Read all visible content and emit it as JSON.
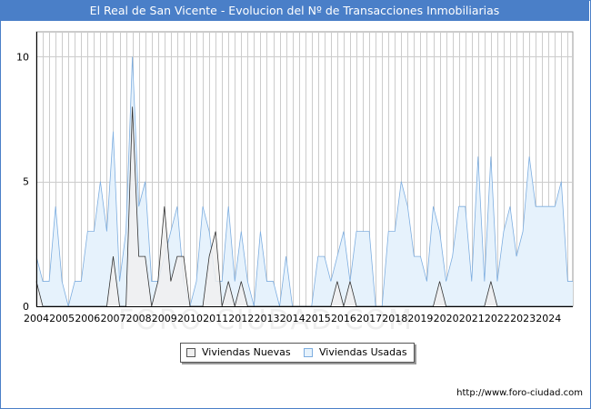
{
  "chart_data": {
    "type": "area",
    "title": "El Real de San Vicente - Evolucion del Nº de Transacciones Inmobiliarias",
    "xlabel": "",
    "ylabel": "",
    "x_tick_labels": [
      "2004",
      "2005",
      "2006",
      "2007",
      "2008",
      "2009",
      "2010",
      "2011",
      "2012",
      "2013",
      "2014",
      "2015",
      "2016",
      "2017",
      "2018",
      "2019",
      "2020",
      "2021",
      "2022",
      "2023",
      "2024"
    ],
    "y_ticks": [
      0,
      5,
      10
    ],
    "xlim": [
      2004,
      2024.95
    ],
    "ylim": [
      0,
      11
    ],
    "grid": true,
    "legend_position": "bottom-center",
    "series": [
      {
        "name": "Viviendas Nuevas",
        "color": "#f0f0f0",
        "stroke": "#333333",
        "x": [
          2004.0,
          2004.25,
          2004.5,
          2004.75,
          2005.0,
          2005.25,
          2005.5,
          2005.75,
          2006.0,
          2006.25,
          2006.5,
          2006.75,
          2007.0,
          2007.25,
          2007.5,
          2007.75,
          2008.0,
          2008.25,
          2008.5,
          2008.75,
          2009.0,
          2009.25,
          2009.5,
          2009.75,
          2010.0,
          2010.25,
          2010.5,
          2010.75,
          2011.0,
          2011.25,
          2011.5,
          2011.75,
          2012.0,
          2012.25,
          2012.5,
          2012.75,
          2013.0,
          2013.25,
          2013.5,
          2013.75,
          2014.0,
          2014.25,
          2014.5,
          2014.75,
          2015.0,
          2015.25,
          2015.5,
          2015.75,
          2016.0,
          2016.25,
          2016.5,
          2016.75,
          2017.0,
          2017.25,
          2017.5,
          2017.75,
          2018.0,
          2018.25,
          2018.5,
          2018.75,
          2019.0,
          2019.25,
          2019.5,
          2019.75,
          2020.0,
          2020.25,
          2020.5,
          2020.75,
          2021.0,
          2021.25,
          2021.5,
          2021.75,
          2022.0,
          2022.25,
          2022.5,
          2022.75,
          2023.0,
          2023.25,
          2023.5,
          2023.75,
          2024.0,
          2024.25,
          2024.5,
          2024.75,
          2024.95
        ],
        "values": [
          1,
          0,
          0,
          0,
          0,
          0,
          0,
          0,
          0,
          0,
          0,
          0,
          2,
          0,
          0,
          8,
          2,
          2,
          0,
          1,
          4,
          1,
          2,
          2,
          0,
          0,
          0,
          2,
          3,
          0,
          1,
          0,
          1,
          0,
          0,
          0,
          0,
          0,
          0,
          0,
          0,
          0,
          0,
          0,
          0,
          0,
          0,
          1,
          0,
          1,
          0,
          0,
          0,
          0,
          0,
          0,
          0,
          0,
          0,
          0,
          0,
          0,
          0,
          1,
          0,
          0,
          0,
          0,
          0,
          0,
          0,
          1,
          0,
          0,
          0,
          0,
          0,
          0,
          0,
          0,
          0,
          0,
          0,
          0,
          0
        ]
      },
      {
        "name": "Viviendas Usadas",
        "color": "#e6f2fc",
        "stroke": "#7eaee0",
        "x": [
          2004.0,
          2004.25,
          2004.5,
          2004.75,
          2005.0,
          2005.25,
          2005.5,
          2005.75,
          2006.0,
          2006.25,
          2006.5,
          2006.75,
          2007.0,
          2007.25,
          2007.5,
          2007.75,
          2008.0,
          2008.25,
          2008.5,
          2008.75,
          2009.0,
          2009.25,
          2009.5,
          2009.75,
          2010.0,
          2010.25,
          2010.5,
          2010.75,
          2011.0,
          2011.25,
          2011.5,
          2011.75,
          2012.0,
          2012.25,
          2012.5,
          2012.75,
          2013.0,
          2013.25,
          2013.5,
          2013.75,
          2014.0,
          2014.25,
          2014.5,
          2014.75,
          2015.0,
          2015.25,
          2015.5,
          2015.75,
          2016.0,
          2016.25,
          2016.5,
          2016.75,
          2017.0,
          2017.25,
          2017.5,
          2017.75,
          2018.0,
          2018.25,
          2018.5,
          2018.75,
          2019.0,
          2019.25,
          2019.5,
          2019.75,
          2020.0,
          2020.25,
          2020.5,
          2020.75,
          2021.0,
          2021.25,
          2021.5,
          2021.75,
          2022.0,
          2022.25,
          2022.5,
          2022.75,
          2023.0,
          2023.25,
          2023.5,
          2023.75,
          2024.0,
          2024.25,
          2024.5,
          2024.75,
          2024.95
        ],
        "values": [
          2,
          1,
          1,
          4,
          1,
          0,
          1,
          1,
          3,
          3,
          5,
          3,
          7,
          1,
          3,
          10,
          4,
          5,
          1,
          1,
          2,
          3,
          4,
          1,
          0,
          1,
          4,
          3,
          1,
          1,
          4,
          1,
          3,
          1,
          0,
          3,
          1,
          1,
          0,
          2,
          0,
          0,
          0,
          0,
          2,
          2,
          1,
          2,
          3,
          1,
          3,
          3,
          3,
          0,
          0,
          3,
          3,
          5,
          4,
          2,
          2,
          1,
          4,
          3,
          1,
          2,
          4,
          4,
          1,
          6,
          1,
          6,
          1,
          3,
          4,
          2,
          3,
          6,
          4,
          4,
          4,
          4,
          5,
          1,
          1
        ]
      }
    ]
  },
  "legend": {
    "items": [
      {
        "label": "Viviendas Nuevas",
        "color": "#f0f0f0"
      },
      {
        "label": "Viviendas Usadas",
        "color": "#e6f2fc"
      }
    ]
  },
  "footer": {
    "source": "http://www.foro-ciudad.com",
    "watermark": "FORO-CIUDAD.COM"
  },
  "colors": {
    "header_bg": "#4a7fc8",
    "grid": "#cccccc",
    "axis": "#000000"
  }
}
